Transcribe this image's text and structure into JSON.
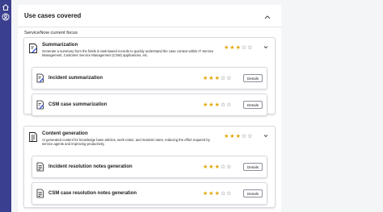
{
  "sidebar": {
    "icons": [
      "home-icon",
      "user-circle-icon"
    ]
  },
  "panel": {
    "title": "Use cases covered",
    "subtitle": "ServiceNow current focus"
  },
  "categories": [
    {
      "title": "Summarization",
      "description": "Generate a summary from the fields in task-based records to quickly understand the case context within IT Service Management, Customer Service Management (CSM) applications, etc.",
      "rating": 3,
      "max_rating": 5,
      "cases": [
        {
          "title": "Incident summarization",
          "rating": 3,
          "details_label": "Details"
        },
        {
          "title": "CSM case summarization",
          "rating": 3,
          "details_label": "Details"
        }
      ]
    },
    {
      "title": "Content generation",
      "description": "AI generated content for knowledge base articles, work notes, and incident notes, reducing the effort required by service agents and improving productivity.",
      "rating": 3,
      "max_rating": 5,
      "cases": [
        {
          "title": "Incident resolution notes generation",
          "rating": 3,
          "details_label": "Details"
        },
        {
          "title": "CSM case resolution notes generation",
          "rating": 3,
          "details_label": "Details"
        }
      ]
    }
  ],
  "colors": {
    "sidebar": "#3b3f8f",
    "star_filled": "#e0a400",
    "star_empty": "#555555"
  }
}
